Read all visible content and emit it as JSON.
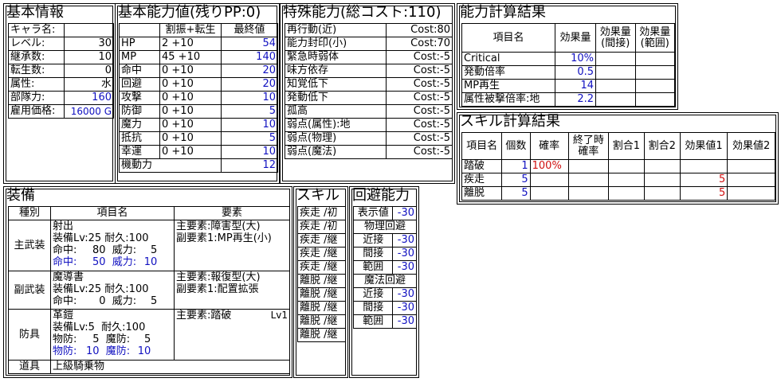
{
  "basic_info": {
    "title": "基本情報",
    "rows": [
      {
        "label": "キャラ名:",
        "value": ""
      },
      {
        "label": "レベル:",
        "value": "30"
      },
      {
        "label": "継承数:",
        "value": "10"
      },
      {
        "label": "転生数:",
        "value": "0"
      },
      {
        "label": "属性:",
        "value": "水"
      },
      {
        "label": "部隊力:",
        "value": "160"
      },
      {
        "label": "雇用価格:",
        "value": "16000 G"
      }
    ]
  },
  "basic_stats": {
    "title": "基本能力値(残りPP:0)",
    "headers": [
      "",
      "割振+転生",
      "最終値"
    ],
    "rows": [
      {
        "name": "HP",
        "alloc": "2 +10",
        "final": "54"
      },
      {
        "name": "MP",
        "alloc": "45 +10",
        "final": "140"
      },
      {
        "name": "命中",
        "alloc": "0 +10",
        "final": "20"
      },
      {
        "name": "回避",
        "alloc": "0 +10",
        "final": "20"
      },
      {
        "name": "攻撃",
        "alloc": "0 +10",
        "final": "10"
      },
      {
        "name": "防御",
        "alloc": "0 +10",
        "final": "5"
      },
      {
        "name": "魔力",
        "alloc": "0 +10",
        "final": "10"
      },
      {
        "name": "抵抗",
        "alloc": "0 +10",
        "final": "5"
      },
      {
        "name": "幸運",
        "alloc": "0 +10",
        "final": "10"
      },
      {
        "name": "機動力",
        "alloc": "",
        "final": "12"
      }
    ]
  },
  "special": {
    "title": "特殊能力(総コスト:110)",
    "rows": [
      {
        "name": "再行動(近)",
        "cost": "Cost:80"
      },
      {
        "name": "能力封印(小)",
        "cost": "Cost:70"
      },
      {
        "name": "緊急時弱体",
        "cost": "Cost:-5"
      },
      {
        "name": "味方依存",
        "cost": "Cost:-5"
      },
      {
        "name": "知覚低下",
        "cost": "Cost:-5"
      },
      {
        "name": "発動低下",
        "cost": "Cost:-5"
      },
      {
        "name": "孤高",
        "cost": "Cost:-5"
      },
      {
        "name": "弱点(属性):地",
        "cost": "Cost:-5"
      },
      {
        "name": "弱点(物理)",
        "cost": "Cost:-5"
      },
      {
        "name": "弱点(魔法)",
        "cost": "Cost:-5"
      }
    ]
  },
  "ability_calc": {
    "title": "能力計算結果",
    "headers": [
      "項目名",
      "効果量",
      "効果量\n(間接)",
      "効果量\n(範囲)"
    ],
    "rows": [
      {
        "name": "Critical",
        "v1": "10%",
        "v2": "",
        "v3": ""
      },
      {
        "name": "発動倍率",
        "v1": "0.5",
        "v2": "",
        "v3": ""
      },
      {
        "name": "MP再生",
        "v1": "14",
        "v2": "",
        "v3": ""
      },
      {
        "name": "属性被撃倍率:地",
        "v1": "2.2",
        "v2": "",
        "v3": ""
      }
    ]
  },
  "skill_calc": {
    "title": "スキル計算結果",
    "headers": [
      "項目名",
      "個数",
      "確率",
      "終了時\n確率",
      "割合1",
      "割合2",
      "効果値1",
      "効果値2"
    ],
    "rows": [
      {
        "name": "踏破",
        "count": "1",
        "rate": "100%",
        "end": "",
        "p1": "",
        "p2": "",
        "e1": "",
        "e2": ""
      },
      {
        "name": "疾走",
        "count": "5",
        "rate": "",
        "end": "",
        "p1": "",
        "p2": "",
        "e1": "5",
        "e2": ""
      },
      {
        "name": "離脱",
        "count": "5",
        "rate": "",
        "end": "",
        "p1": "",
        "p2": "",
        "e1": "5",
        "e2": ""
      }
    ]
  },
  "equipment": {
    "title": "装備",
    "headers": [
      "種別",
      "項目名",
      "要素"
    ],
    "main_weapon": {
      "type": "主武装",
      "name": "射出",
      "l1a": "装備Lv:25",
      "l1b": "耐久:100",
      "l2a": "命中:",
      "l2av": "80",
      "l2b": "威力:",
      "l2bv": "5",
      "l3a": "命中:",
      "l3av": "50",
      "l3b": "威力:",
      "l3bv": "10",
      "elem1": "主要素:障害型(大)",
      "elem2": "副要素1:MP再生(小)"
    },
    "sub_weapon": {
      "type": "副武装",
      "name": "魔導書",
      "l1a": "装備Lv:25",
      "l1b": "耐久:100",
      "l2a": "命中:",
      "l2av": "0",
      "l2b": "威力:",
      "l2bv": "5",
      "elem1": "主要素:報復型(大)",
      "elem2": "副要素1:配置拡張"
    },
    "armor": {
      "type": "防具",
      "name": "革鎧",
      "l1a": "装備Lv:5",
      "l1b": "耐久:100",
      "l2a": "物防:",
      "l2av": "5",
      "l2b": "魔防:",
      "l2bv": "5",
      "l3a": "物防:",
      "l3av": "10",
      "l3b": "魔防:",
      "l3bv": "10",
      "elem1": "主要素:踏破",
      "elem1_lv": "Lv1"
    },
    "tool": {
      "type": "道具",
      "name": "上級騎乗物"
    }
  },
  "skills": {
    "title": "スキル",
    "items": [
      "疾走 /初",
      "疾走 /初",
      "疾走 /継",
      "疾走 /継",
      "疾走 /継",
      "離脱 /継",
      "離脱 /継",
      "離脱 /継",
      "離脱 /継",
      "離脱 /継"
    ]
  },
  "evasion": {
    "title": "回避能力",
    "display_label": "表示値",
    "display_value": "-30",
    "phys_label": "物理回避",
    "phys": [
      {
        "label": "近接",
        "value": "-30"
      },
      {
        "label": "間接",
        "value": "-30"
      },
      {
        "label": "範囲",
        "value": "-30"
      }
    ],
    "magic_label": "魔法回避",
    "magic": [
      {
        "label": "近接",
        "value": "-30"
      },
      {
        "label": "間接",
        "value": "-30"
      },
      {
        "label": "範囲",
        "value": "-30"
      }
    ]
  }
}
